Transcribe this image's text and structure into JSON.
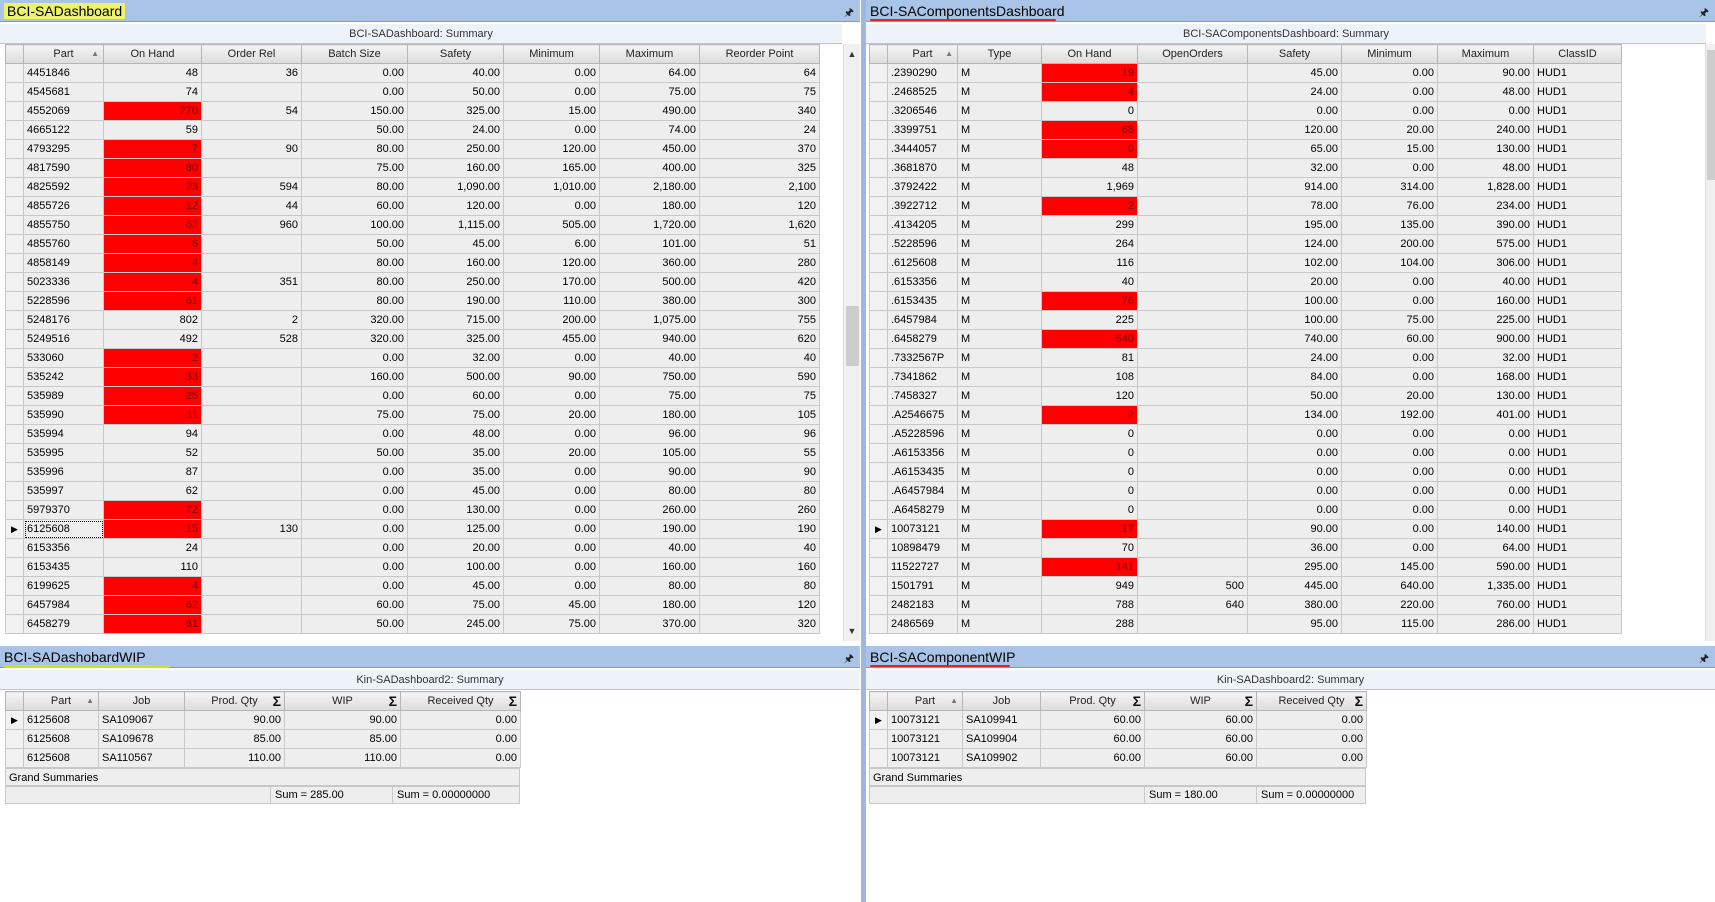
{
  "panels": {
    "sa_dashboard": {
      "title": "BCI-SADashboard",
      "summary": "BCI-SADashboard: Summary",
      "columns": [
        "Part",
        "On Hand",
        "Order Rel",
        "Batch Size",
        "Safety",
        "Minimum",
        "Maximum",
        "Reorder Point"
      ],
      "rows": [
        [
          "4451846",
          "48",
          "36",
          "0.00",
          "40.00",
          "0.00",
          "64.00",
          "64"
        ],
        [
          "4545681",
          "74",
          "",
          "0.00",
          "50.00",
          "0.00",
          "75.00",
          "75"
        ],
        [
          "4552069",
          "270",
          "54",
          "150.00",
          "325.00",
          "15.00",
          "490.00",
          "340"
        ],
        [
          "4665122",
          "59",
          "",
          "50.00",
          "24.00",
          "0.00",
          "74.00",
          "24"
        ],
        [
          "4793295",
          "7",
          "90",
          "80.00",
          "250.00",
          "120.00",
          "450.00",
          "370"
        ],
        [
          "4817590",
          "80",
          "",
          "75.00",
          "160.00",
          "165.00",
          "400.00",
          "325"
        ],
        [
          "4825592",
          "23",
          "594",
          "80.00",
          "1,090.00",
          "1,010.00",
          "2,180.00",
          "2,100"
        ],
        [
          "4855726",
          "12",
          "44",
          "60.00",
          "120.00",
          "0.00",
          "180.00",
          "120"
        ],
        [
          "4855750",
          "62",
          "960",
          "100.00",
          "1,115.00",
          "505.00",
          "1,720.00",
          "1,620"
        ],
        [
          "4855760",
          "6",
          "",
          "50.00",
          "45.00",
          "6.00",
          "101.00",
          "51"
        ],
        [
          "4858149",
          "4",
          "",
          "80.00",
          "160.00",
          "120.00",
          "360.00",
          "280"
        ],
        [
          "5023336",
          "4",
          "351",
          "80.00",
          "250.00",
          "170.00",
          "500.00",
          "420"
        ],
        [
          "5228596",
          "61",
          "",
          "80.00",
          "190.00",
          "110.00",
          "380.00",
          "300"
        ],
        [
          "5248176",
          "802",
          "2",
          "320.00",
          "715.00",
          "200.00",
          "1,075.00",
          "755"
        ],
        [
          "5249516",
          "492",
          "528",
          "320.00",
          "325.00",
          "455.00",
          "940.00",
          "620"
        ],
        [
          "533060",
          "2",
          "",
          "0.00",
          "32.00",
          "0.00",
          "40.00",
          "40"
        ],
        [
          "535242",
          "33",
          "",
          "160.00",
          "500.00",
          "90.00",
          "750.00",
          "590"
        ],
        [
          "535989",
          "25",
          "",
          "0.00",
          "60.00",
          "0.00",
          "75.00",
          "75"
        ],
        [
          "535990",
          "11",
          "",
          "75.00",
          "75.00",
          "20.00",
          "180.00",
          "105"
        ],
        [
          "535994",
          "94",
          "",
          "0.00",
          "48.00",
          "0.00",
          "96.00",
          "96"
        ],
        [
          "535995",
          "52",
          "",
          "50.00",
          "35.00",
          "20.00",
          "105.00",
          "55"
        ],
        [
          "535996",
          "87",
          "",
          "0.00",
          "35.00",
          "0.00",
          "90.00",
          "90"
        ],
        [
          "535997",
          "62",
          "",
          "0.00",
          "45.00",
          "0.00",
          "80.00",
          "80"
        ],
        [
          "5979370",
          "72",
          "",
          "0.00",
          "130.00",
          "0.00",
          "260.00",
          "260"
        ],
        [
          "6125608",
          "15",
          "130",
          "0.00",
          "125.00",
          "0.00",
          "190.00",
          "190"
        ],
        [
          "6153356",
          "24",
          "",
          "0.00",
          "20.00",
          "0.00",
          "40.00",
          "40"
        ],
        [
          "6153435",
          "110",
          "",
          "0.00",
          "100.00",
          "0.00",
          "160.00",
          "160"
        ],
        [
          "6199625",
          "4",
          "",
          "0.00",
          "45.00",
          "0.00",
          "80.00",
          "80"
        ],
        [
          "6457984",
          "62",
          "",
          "60.00",
          "75.00",
          "45.00",
          "180.00",
          "120"
        ],
        [
          "6458279",
          "61",
          "",
          "50.00",
          "245.00",
          "75.00",
          "370.00",
          "320"
        ]
      ],
      "red_rows": [
        2,
        4,
        5,
        6,
        7,
        8,
        9,
        10,
        11,
        12,
        15,
        16,
        17,
        18,
        23,
        24,
        27,
        28,
        29
      ],
      "current_row": 24
    },
    "sa_components": {
      "title": "BCI-SAComponentsDashboard",
      "summary": "BCI-SAComponentsDashboard: Summary",
      "columns": [
        "Part",
        "Type",
        "On Hand",
        "OpenOrders",
        "Safety",
        "Minimum",
        "Maximum",
        "ClassID"
      ],
      "rows": [
        [
          ".2390290",
          "M",
          "19",
          "",
          "45.00",
          "0.00",
          "90.00",
          "HUD1"
        ],
        [
          ".2468525",
          "M",
          "4",
          "",
          "24.00",
          "0.00",
          "48.00",
          "HUD1"
        ],
        [
          ".3206546",
          "M",
          "0",
          "",
          "0.00",
          "0.00",
          "0.00",
          "HUD1"
        ],
        [
          ".3399751",
          "M",
          "68",
          "",
          "120.00",
          "20.00",
          "240.00",
          "HUD1"
        ],
        [
          ".3444057",
          "M",
          "0",
          "",
          "65.00",
          "15.00",
          "130.00",
          "HUD1"
        ],
        [
          ".3681870",
          "M",
          "48",
          "",
          "32.00",
          "0.00",
          "48.00",
          "HUD1"
        ],
        [
          ".3792422",
          "M",
          "1,969",
          "",
          "914.00",
          "314.00",
          "1,828.00",
          "HUD1"
        ],
        [
          ".3922712",
          "M",
          "2",
          "",
          "78.00",
          "76.00",
          "234.00",
          "HUD1"
        ],
        [
          ".4134205",
          "M",
          "299",
          "",
          "195.00",
          "135.00",
          "390.00",
          "HUD1"
        ],
        [
          ".5228596",
          "M",
          "264",
          "",
          "124.00",
          "200.00",
          "575.00",
          "HUD1"
        ],
        [
          ".6125608",
          "M",
          "116",
          "",
          "102.00",
          "104.00",
          "306.00",
          "HUD1"
        ],
        [
          ".6153356",
          "M",
          "40",
          "",
          "20.00",
          "0.00",
          "40.00",
          "HUD1"
        ],
        [
          ".6153435",
          "M",
          "76",
          "",
          "100.00",
          "0.00",
          "160.00",
          "HUD1"
        ],
        [
          ".6457984",
          "M",
          "225",
          "",
          "100.00",
          "75.00",
          "225.00",
          "HUD1"
        ],
        [
          ".6458279",
          "M",
          "640",
          "",
          "740.00",
          "60.00",
          "900.00",
          "HUD1"
        ],
        [
          ".7332567P",
          "M",
          "81",
          "",
          "24.00",
          "0.00",
          "32.00",
          "HUD1"
        ],
        [
          ".7341862",
          "M",
          "108",
          "",
          "84.00",
          "0.00",
          "168.00",
          "HUD1"
        ],
        [
          ".7458327",
          "M",
          "120",
          "",
          "50.00",
          "20.00",
          "130.00",
          "HUD1"
        ],
        [
          ".A2546675",
          "M",
          "2",
          "",
          "134.00",
          "192.00",
          "401.00",
          "HUD1"
        ],
        [
          ".A5228596",
          "M",
          "0",
          "",
          "0.00",
          "0.00",
          "0.00",
          "HUD1"
        ],
        [
          ".A6153356",
          "M",
          "0",
          "",
          "0.00",
          "0.00",
          "0.00",
          "HUD1"
        ],
        [
          ".A6153435",
          "M",
          "0",
          "",
          "0.00",
          "0.00",
          "0.00",
          "HUD1"
        ],
        [
          ".A6457984",
          "M",
          "0",
          "",
          "0.00",
          "0.00",
          "0.00",
          "HUD1"
        ],
        [
          ".A6458279",
          "M",
          "0",
          "",
          "0.00",
          "0.00",
          "0.00",
          "HUD1"
        ],
        [
          "10073121",
          "M",
          "17",
          "",
          "90.00",
          "0.00",
          "140.00",
          "HUD1"
        ],
        [
          "10898479",
          "M",
          "70",
          "",
          "36.00",
          "0.00",
          "64.00",
          "HUD1"
        ],
        [
          "11522727",
          "M",
          "141",
          "",
          "295.00",
          "145.00",
          "590.00",
          "HUD1"
        ],
        [
          "1501791",
          "M",
          "949",
          "500",
          "445.00",
          "640.00",
          "1,335.00",
          "HUD1"
        ],
        [
          "2482183",
          "M",
          "788",
          "640",
          "380.00",
          "220.00",
          "760.00",
          "HUD1"
        ],
        [
          "2486569",
          "M",
          "288",
          "",
          "95.00",
          "115.00",
          "286.00",
          "HUD1"
        ]
      ],
      "red_rows": [
        0,
        1,
        3,
        4,
        7,
        12,
        14,
        18,
        24,
        26
      ],
      "current_row": 24
    },
    "sa_wip": {
      "title": "BCI-SADashobardWIP",
      "summary": "Kin-SADashboard2: Summary",
      "columns": [
        "Part",
        "Job",
        "Prod. Qty",
        "WIP",
        "Received Qty"
      ],
      "rows": [
        [
          "6125608",
          "SA109067",
          "90.00",
          "90.00",
          "0.00"
        ],
        [
          "6125608",
          "SA109678",
          "85.00",
          "85.00",
          "0.00"
        ],
        [
          "6125608",
          "SA110567",
          "110.00",
          "110.00",
          "0.00"
        ]
      ],
      "grand_label": "Grand Summaries",
      "sums": [
        "Sum = 285.00",
        "Sum = 0.00000000"
      ]
    },
    "sa_comp_wip": {
      "title": "BCI-SAComponentWIP",
      "summary": "Kin-SADashboard2: Summary",
      "columns": [
        "Part",
        "Job",
        "Prod. Qty",
        "WIP",
        "Received Qty"
      ],
      "rows": [
        [
          "10073121",
          "SA109941",
          "60.00",
          "60.00",
          "0.00"
        ],
        [
          "10073121",
          "SA109904",
          "60.00",
          "60.00",
          "0.00"
        ],
        [
          "10073121",
          "SA109902",
          "60.00",
          "60.00",
          "0.00"
        ]
      ],
      "grand_label": "Grand Summaries",
      "sums": [
        "Sum = 180.00",
        "Sum = 0.00000000"
      ]
    }
  },
  "icons": {
    "pin": "pin-icon",
    "sigma": "sigma-icon",
    "row_pointer": "row-pointer-icon"
  },
  "colors": {
    "title_bar": "#a9c4e6",
    "alert_red": "#ff0000",
    "highlight_yellow": "#eef36b",
    "annotation_red": "#e8231f",
    "annotation_green": "#c8e61b"
  }
}
